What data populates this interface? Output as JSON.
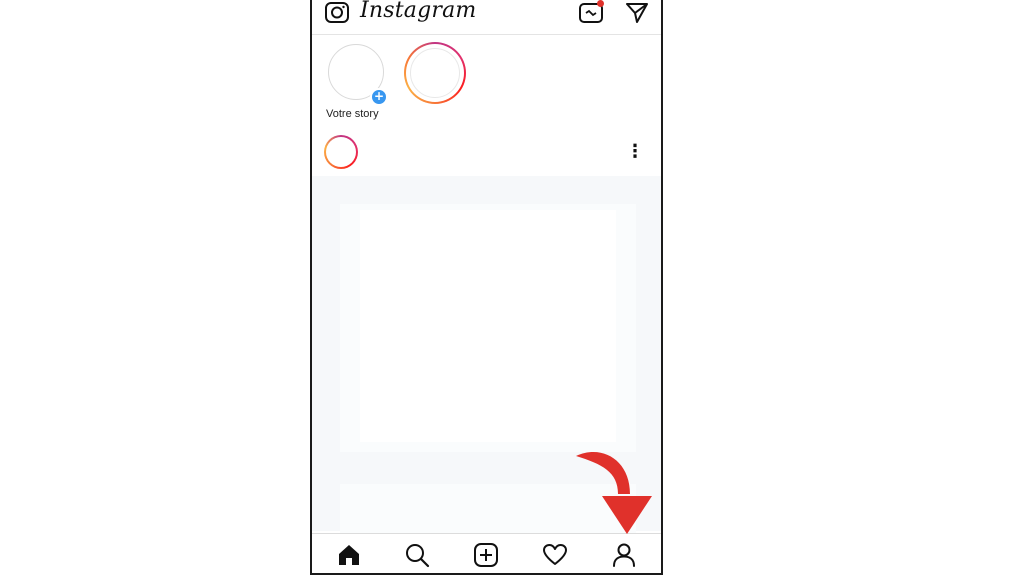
{
  "app": {
    "logo_text": "Instagram",
    "has_notification": true
  },
  "stories": {
    "own_label": "Votre story"
  },
  "colors": {
    "accent": "#3897f0",
    "notification": "#e0312b",
    "arrow": "#e0312b"
  },
  "icons": {
    "top": [
      "camera-icon",
      "igtv-icon",
      "direct-message-icon"
    ],
    "bottom_nav": [
      "home-icon",
      "search-icon",
      "add-post-icon",
      "heart-icon",
      "profile-icon"
    ],
    "post": [
      "more-options-icon"
    ]
  }
}
